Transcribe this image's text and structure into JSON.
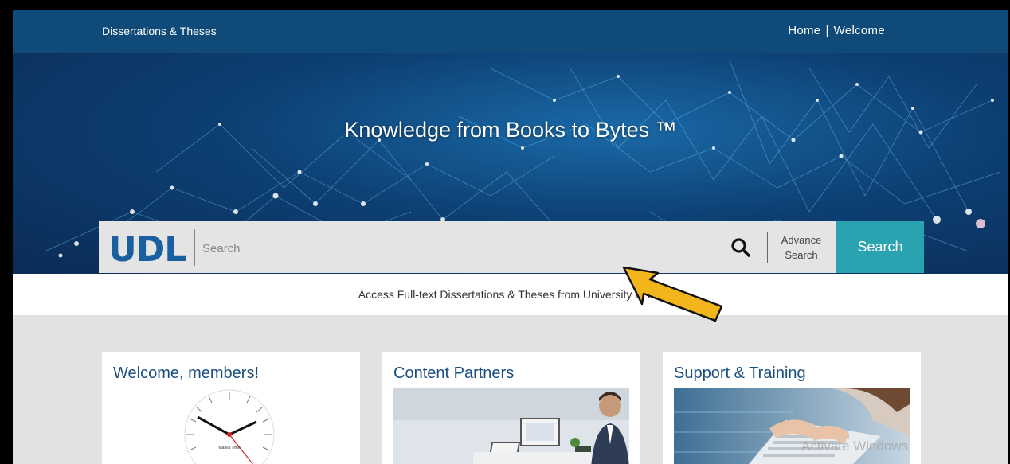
{
  "header": {
    "brand": "Dissertations & Theses",
    "nav": [
      "Home",
      "|",
      "Welcome"
    ]
  },
  "hero": {
    "title": "Knowledge from Books to Bytes ™"
  },
  "search": {
    "logo_text": "UDL",
    "placeholder": "Search",
    "advance_line1": "Advance",
    "advance_line2": "Search",
    "button_label": "Search"
  },
  "subtitle": "Access Full-text Dissertations & Theses from University of Ma",
  "cards": [
    {
      "title": "Welcome, members!"
    },
    {
      "title": "Content Partners"
    },
    {
      "title": "Support & Training"
    }
  ],
  "clock_label": "Manila Time",
  "watermark": "Activate Windows",
  "colors": {
    "topbar": "#0f4a78",
    "accent": "#2aa3b0",
    "heading": "#1a4f80",
    "arrow": "#f2b51c"
  }
}
